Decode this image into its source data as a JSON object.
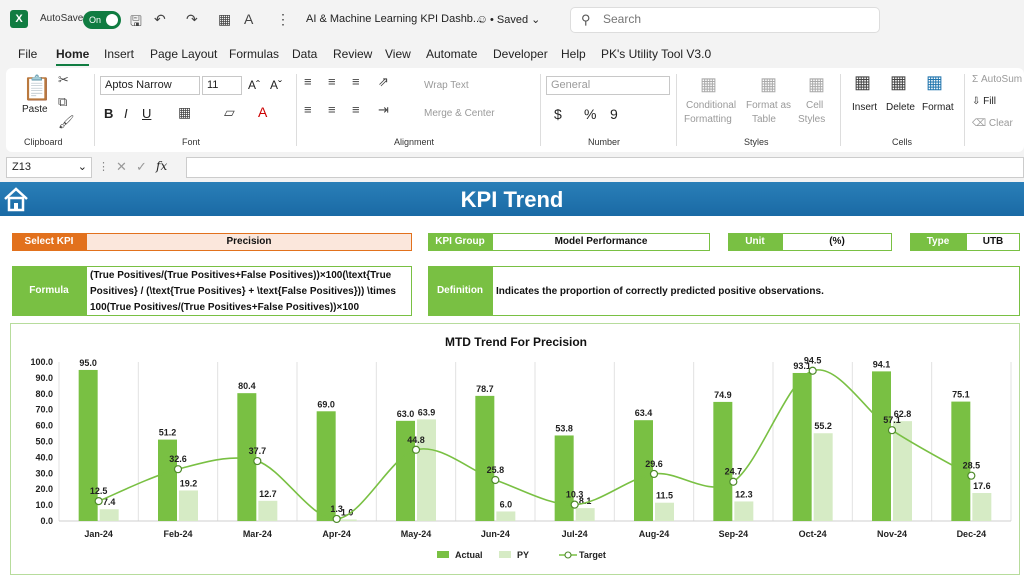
{
  "app": {
    "autosave_label": "AutoSave",
    "autosave_state": "On",
    "document_title": "AI & Machine Learning KPI Dashb...",
    "save_status": "Saved",
    "search_placeholder": "Search",
    "accent_color": "#107c41"
  },
  "menu": [
    "File",
    "Home",
    "Insert",
    "Page Layout",
    "Formulas",
    "Data",
    "Review",
    "View",
    "Automate",
    "Developer",
    "Help",
    "PK's Utility Tool V3.0"
  ],
  "menu_active": "Home",
  "ribbon": {
    "clipboard": {
      "paste": "Paste",
      "label": "Clipboard"
    },
    "font": {
      "family": "Aptos Narrow",
      "size": "11",
      "label": "Font",
      "bold": "B",
      "italic": "I",
      "underline": "U"
    },
    "alignment": {
      "wrap": "Wrap Text",
      "merge": "Merge & Center",
      "label": "Alignment"
    },
    "number": {
      "format": "General",
      "label": "Number",
      "currency": "$",
      "percent": "%",
      "comma": "9"
    },
    "styles": {
      "conditional": "Conditional",
      "conditional2": "Formatting",
      "format_as": "Format as",
      "table": "Table",
      "cell": "Cell",
      "cell_styles": "Styles",
      "label": "Styles"
    },
    "cells": {
      "insert": "Insert",
      "delete": "Delete",
      "format": "Format",
      "label": "Cells"
    },
    "editing": {
      "autosum": "AutoSum",
      "fill": "Fill",
      "clear": "Clear"
    }
  },
  "formula_bar": {
    "cell_ref": "Z13",
    "fx": "fx",
    "content": ""
  },
  "dashboard": {
    "title": "KPI Trend",
    "select_kpi_label": "Select KPI",
    "select_kpi_value": "Precision",
    "kpi_group_label": "KPI Group",
    "kpi_group_value": "Model Performance",
    "unit_label": "Unit",
    "unit_value": "(%)",
    "type_label": "Type",
    "type_value": "UTB",
    "formula_label": "Formula",
    "formula_line1": "(True Positives/(True Positives+False Positives))×100(\\text{True",
    "formula_line2": "Positives} / (\\text{True Positives} + \\text{False Positives})) \\times",
    "formula_line3": "100(True Positives/(True Positives+False Positives))×100",
    "definition_label": "Definition",
    "definition_value": "Indicates the proportion of correctly predicted positive observations.",
    "colors": {
      "orange": "#e2711d",
      "green": "#79c043",
      "banner": "#1f74ad"
    }
  },
  "chart_data": {
    "type": "bar",
    "title": "MTD Trend For Precision",
    "categories": [
      "Jan-24",
      "Feb-24",
      "Mar-24",
      "Apr-24",
      "May-24",
      "Jun-24",
      "Jul-24",
      "Aug-24",
      "Sep-24",
      "Oct-24",
      "Nov-24",
      "Dec-24"
    ],
    "series": [
      {
        "name": "Actual",
        "kind": "bar",
        "color": "#79c043",
        "values": [
          95.0,
          51.2,
          80.4,
          69.0,
          63.0,
          78.7,
          53.8,
          63.4,
          74.9,
          93.1,
          94.1,
          75.1
        ]
      },
      {
        "name": "PY",
        "kind": "bar",
        "color": "#d6ebc5",
        "values": [
          7.4,
          19.2,
          12.7,
          1.0,
          63.9,
          6.0,
          8.1,
          11.5,
          12.3,
          55.2,
          62.8,
          17.6
        ]
      },
      {
        "name": "Target",
        "kind": "line-smooth",
        "color": "#79c043",
        "values": [
          12.5,
          32.6,
          37.7,
          1.3,
          44.8,
          25.8,
          10.3,
          29.6,
          24.7,
          94.5,
          57.1,
          28.5
        ]
      }
    ],
    "ylim": [
      0,
      100
    ],
    "yticks": [
      "0.0",
      "10.0",
      "20.0",
      "30.0",
      "40.0",
      "50.0",
      "60.0",
      "70.0",
      "80.0",
      "90.0",
      "100.0"
    ],
    "grid": "vertical category lines",
    "legend": "bottom-center"
  }
}
